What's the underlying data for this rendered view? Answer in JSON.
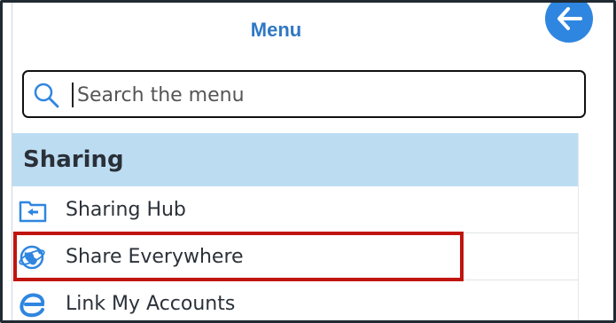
{
  "header": {
    "title": "Menu",
    "back_icon": "arrow-left-icon"
  },
  "search": {
    "placeholder": "Search the menu",
    "value": "",
    "icon": "search-icon"
  },
  "section": {
    "title": "Sharing"
  },
  "items": [
    {
      "label": "Sharing Hub",
      "icon": "sharing-hub-folder-icon"
    },
    {
      "label": "Share Everywhere",
      "icon": "share-everywhere-globe-icon",
      "highlighted": true
    },
    {
      "label": "Link My Accounts",
      "icon": "link-accounts-e-icon"
    }
  ],
  "colors": {
    "accent": "#2f78c4",
    "section_bg": "#bcdcf2",
    "highlight_border": "#c0140f"
  }
}
